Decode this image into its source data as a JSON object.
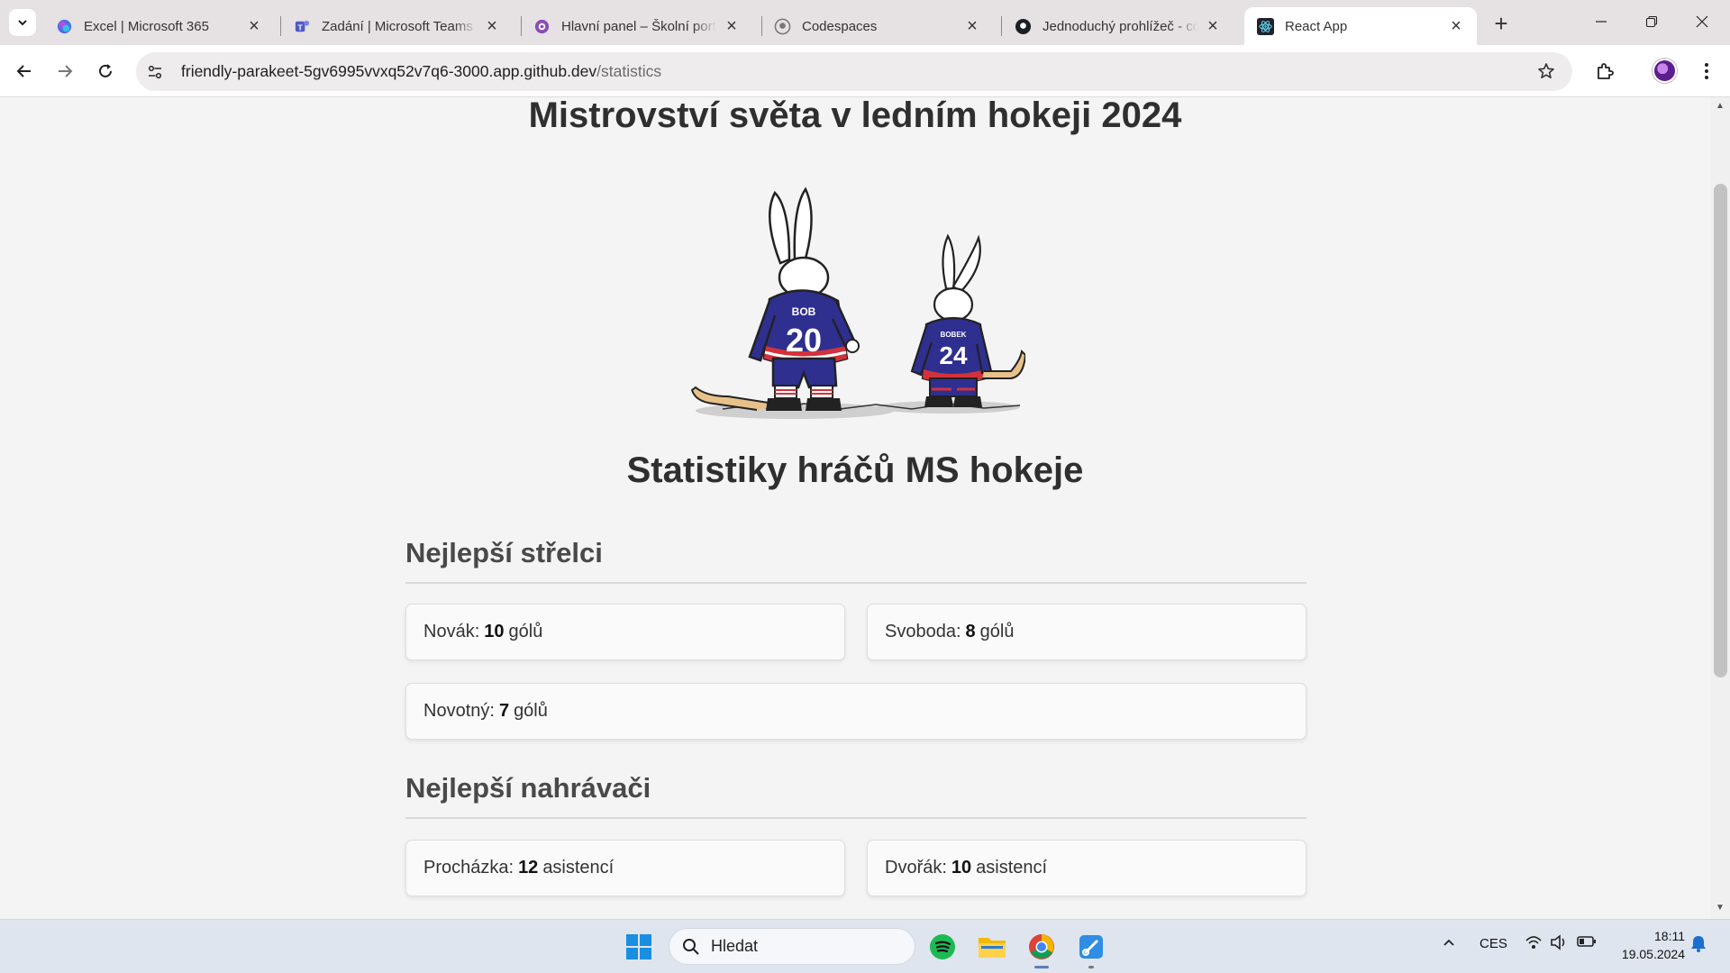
{
  "browser": {
    "tabs": [
      {
        "title": "Excel | Microsoft 365",
        "icon": "copilot-icon"
      },
      {
        "title": "Zadání | Microsoft Teams c",
        "icon": "teams-icon"
      },
      {
        "title": "Hlavní panel – Školní portá",
        "icon": "school-portal-icon"
      },
      {
        "title": "Codespaces",
        "icon": "github-icon"
      },
      {
        "title": "Jednoduchý prohlížeč - co",
        "icon": "github-icon"
      },
      {
        "title": "React App",
        "icon": "react-icon"
      }
    ],
    "active_tab": 5,
    "url_host": "friendly-parakeet-5gv6995vvxq52v7q6-3000.app.github.dev",
    "url_path": "/statistics"
  },
  "page": {
    "title": "Mistrovství světa v ledním hokeji 2024",
    "mascots": {
      "player1_name": "BOB",
      "player1_number": "20",
      "player2_name": "BOBEK",
      "player2_number": "24"
    },
    "stats_title": "Statistiky hráčů MS hokeje",
    "scorers": {
      "heading": "Nejlepší střelci",
      "items": [
        {
          "name": "Novák:",
          "value": "10",
          "unit": "gólů"
        },
        {
          "name": "Svoboda:",
          "value": "8",
          "unit": "gólů"
        },
        {
          "name": "Novotný:",
          "value": "7",
          "unit": "gólů"
        }
      ]
    },
    "assists": {
      "heading": "Nejlepší nahrávači",
      "items": [
        {
          "name": "Procházka:",
          "value": "12",
          "unit": "asistencí"
        },
        {
          "name": "Dvořák:",
          "value": "10",
          "unit": "asistencí"
        }
      ]
    }
  },
  "taskbar": {
    "search_label": "Hledat",
    "language": "CES",
    "time": "18:11",
    "date": "19.05.2024"
  },
  "colors": {
    "accent": "#2b2f8f",
    "jersey_blue": "#2e2f8f",
    "jersey_red": "#d2323c"
  }
}
